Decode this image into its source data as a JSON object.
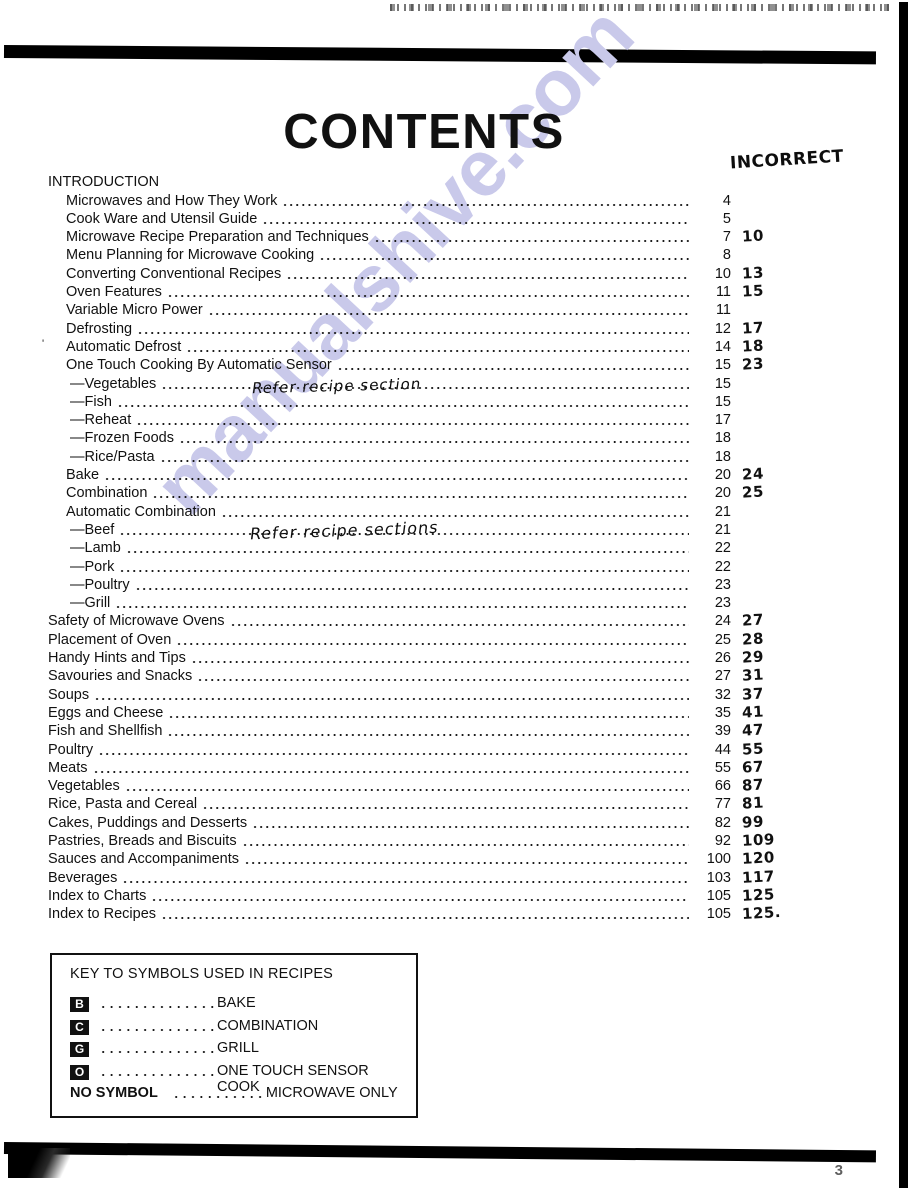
{
  "document": {
    "title": "CONTENTS",
    "page_number": "3",
    "watermark": "manualshive.com"
  },
  "annotations": {
    "incorrect": "INCORRECT",
    "refer_recipe_section": "Refer   recipe   section",
    "refer_recipe_sections": "Refer   recipe   sections"
  },
  "toc": {
    "entries": [
      {
        "label": "INTRODUCTION",
        "indent": 0,
        "page": "",
        "correction": "",
        "leader": false
      },
      {
        "label": "Microwaves and How They Work",
        "indent": 1,
        "page": "4",
        "correction": "",
        "leader": true
      },
      {
        "label": "Cook Ware and Utensil Guide",
        "indent": 1,
        "page": "5",
        "correction": "",
        "leader": true
      },
      {
        "label": "Microwave Recipe Preparation and Techniques",
        "indent": 1,
        "page": "7",
        "correction": "10",
        "leader": true
      },
      {
        "label": "Menu Planning for Microwave Cooking",
        "indent": 1,
        "page": "8",
        "correction": "",
        "leader": true
      },
      {
        "label": "Converting Conventional Recipes",
        "indent": 1,
        "page": "10",
        "correction": "13",
        "leader": true
      },
      {
        "label": "Oven Features",
        "indent": 1,
        "page": "11",
        "correction": "15",
        "leader": true
      },
      {
        "label": "Variable Micro Power",
        "indent": 1,
        "page": "11",
        "correction": "",
        "leader": true
      },
      {
        "label": "Defrosting",
        "indent": 1,
        "page": "12",
        "correction": "17",
        "leader": true
      },
      {
        "label": "Automatic Defrost",
        "indent": 1,
        "page": "14",
        "correction": "18",
        "leader": true
      },
      {
        "label": "One Touch Cooking By Automatic Sensor",
        "indent": 1,
        "page": "15",
        "correction": "23",
        "leader": true
      },
      {
        "label": "—Vegetables",
        "indent": 2,
        "page": "15",
        "correction": "",
        "leader": true
      },
      {
        "label": "—Fish",
        "indent": 2,
        "page": "15",
        "correction": "",
        "leader": true
      },
      {
        "label": "—Reheat",
        "indent": 2,
        "page": "17",
        "correction": "",
        "leader": true
      },
      {
        "label": "—Frozen Foods",
        "indent": 2,
        "page": "18",
        "correction": "",
        "leader": true
      },
      {
        "label": "—Rice/Pasta",
        "indent": 2,
        "page": "18",
        "correction": "",
        "leader": true
      },
      {
        "label": "Bake",
        "indent": 1,
        "page": "20",
        "correction": "24",
        "leader": true
      },
      {
        "label": "Combination",
        "indent": 1,
        "page": "20",
        "correction": "25",
        "leader": true
      },
      {
        "label": "Automatic Combination",
        "indent": 1,
        "page": "21",
        "correction": "",
        "leader": true
      },
      {
        "label": "—Beef",
        "indent": 2,
        "page": "21",
        "correction": "",
        "leader": true
      },
      {
        "label": "—Lamb",
        "indent": 2,
        "page": "22",
        "correction": "",
        "leader": true
      },
      {
        "label": "—Pork",
        "indent": 2,
        "page": "22",
        "correction": "",
        "leader": true
      },
      {
        "label": "—Poultry",
        "indent": 2,
        "page": "23",
        "correction": "",
        "leader": true
      },
      {
        "label": "—Grill",
        "indent": 2,
        "page": "23",
        "correction": "",
        "leader": true
      },
      {
        "label": "Safety of Microwave Ovens",
        "indent": 0,
        "page": "24",
        "correction": "27",
        "leader": true
      },
      {
        "label": "Placement of Oven",
        "indent": 0,
        "page": "25",
        "correction": "28",
        "leader": true
      },
      {
        "label": "Handy Hints and Tips",
        "indent": 0,
        "page": "26",
        "correction": "29",
        "leader": true
      },
      {
        "label": "Savouries and Snacks",
        "indent": 0,
        "page": "27",
        "correction": "31",
        "leader": true
      },
      {
        "label": "Soups",
        "indent": 0,
        "page": "32",
        "correction": "37",
        "leader": true
      },
      {
        "label": "Eggs and Cheese",
        "indent": 0,
        "page": "35",
        "correction": "41",
        "leader": true
      },
      {
        "label": "Fish and Shellfish",
        "indent": 0,
        "page": "39",
        "correction": "47",
        "leader": true
      },
      {
        "label": "Poultry",
        "indent": 0,
        "page": "44",
        "correction": "55",
        "leader": true
      },
      {
        "label": "Meats",
        "indent": 0,
        "page": "55",
        "correction": "67",
        "leader": true
      },
      {
        "label": "Vegetables",
        "indent": 0,
        "page": "66",
        "correction": "87",
        "leader": true
      },
      {
        "label": "Rice, Pasta and Cereal",
        "indent": 0,
        "page": "77",
        "correction": "81",
        "leader": true
      },
      {
        "label": "Cakes, Puddings and Desserts",
        "indent": 0,
        "page": "82",
        "correction": "99",
        "leader": true
      },
      {
        "label": "Pastries, Breads and Biscuits",
        "indent": 0,
        "page": "92",
        "correction": "109",
        "leader": true
      },
      {
        "label": "Sauces and Accompaniments",
        "indent": 0,
        "page": "100",
        "correction": "120",
        "leader": true
      },
      {
        "label": "Beverages",
        "indent": 0,
        "page": "103",
        "correction": "117",
        "leader": true
      },
      {
        "label": "Index to Charts",
        "indent": 0,
        "page": "105",
        "correction": "125",
        "leader": true
      },
      {
        "label": "Index to Recipes",
        "indent": 0,
        "page": "105",
        "correction": "125.",
        "leader": true
      }
    ]
  },
  "key_box": {
    "title": "KEY TO SYMBOLS USED IN RECIPES",
    "rows": [
      {
        "symbol": "B",
        "boxed": true,
        "text": "BAKE",
        "text2": ""
      },
      {
        "symbol": "C",
        "boxed": true,
        "text": "COMBINATION",
        "text2": ""
      },
      {
        "symbol": "G",
        "boxed": true,
        "text": "GRILL",
        "text2": ""
      },
      {
        "symbol": "O",
        "boxed": true,
        "text": "ONE TOUCH SENSOR",
        "text2": "COOK"
      },
      {
        "symbol": "NO SYMBOL",
        "boxed": false,
        "text": "MICROWAVE ONLY",
        "text2": ""
      }
    ]
  },
  "colors": {
    "ink": "#111111",
    "watermark": "#c9c9ea",
    "paper": "#ffffff"
  }
}
